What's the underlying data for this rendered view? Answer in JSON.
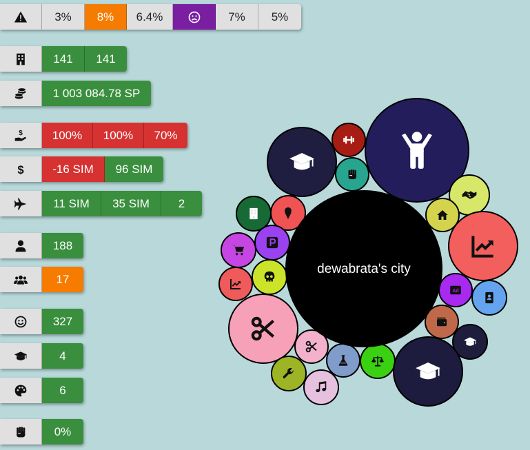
{
  "colors": {
    "background": "#b8d8da",
    "green": "#3a8f3e",
    "red": "#d63232",
    "orange": "#f57c00",
    "purple": "#7b1fa2",
    "grey": "#e0e0e0"
  },
  "stats": {
    "warning_row": {
      "icon": "warning-icon",
      "values": [
        "3%",
        "8%",
        "6.4%",
        "7%",
        "5%"
      ],
      "face_icon": "sad-face-icon"
    },
    "buildings_row": {
      "icon": "building-icon",
      "values": [
        "141",
        "141"
      ]
    },
    "money_row": {
      "icon": "coins-icon",
      "values": [
        "1 003 084.78 SP"
      ]
    },
    "tax_row": {
      "icon": "hand-money-icon",
      "values": [
        "100%",
        "100%",
        "70%"
      ]
    },
    "balance_row": {
      "icon": "dollar-icon",
      "values": [
        "-16 SIM",
        "96 SIM"
      ]
    },
    "travel_row": {
      "icon": "plane-icon",
      "values": [
        "11 SIM",
        "35 SIM",
        "2"
      ]
    },
    "population_row": {
      "icon": "person-icon",
      "values": [
        "188"
      ]
    },
    "groups_row": {
      "icon": "people-icon",
      "values": [
        "17"
      ]
    },
    "happiness_row": {
      "icon": "smile-icon",
      "values": [
        "327"
      ]
    },
    "education_row": {
      "icon": "graduation-cap-icon",
      "values": [
        "4"
      ]
    },
    "culture_row": {
      "icon": "palette-icon",
      "values": [
        "6"
      ]
    },
    "protest_row": {
      "icon": "fist-icon",
      "values": [
        "0%"
      ]
    }
  },
  "city": {
    "name": "dewabrata's city",
    "bubbles": [
      {
        "icon": "graduation-icon",
        "color": "#1f1d40"
      },
      {
        "icon": "dumbbell-icon",
        "color": "#a71d14"
      },
      {
        "icon": "fist-icon",
        "color": "#27a58f"
      },
      {
        "icon": "child-icon",
        "color": "#231d5c"
      },
      {
        "icon": "handshake-icon",
        "color": "#d7e76a"
      },
      {
        "icon": "home-icon",
        "color": "#d4d34e"
      },
      {
        "icon": "chart-icon",
        "color": "#f25f5c"
      },
      {
        "icon": "building-icon",
        "color": "#176a35"
      },
      {
        "icon": "ice-cream-icon",
        "color": "#ef5353"
      },
      {
        "icon": "parking-icon",
        "color": "#9a41f0"
      },
      {
        "icon": "cart-icon",
        "color": "#c646e4"
      },
      {
        "icon": "skull-icon",
        "color": "#cbe42a"
      },
      {
        "icon": "chart-icon",
        "color": "#ef5a5a"
      },
      {
        "icon": "ad-icon",
        "color": "#a829ef"
      },
      {
        "icon": "contact-icon",
        "color": "#64a4ef"
      },
      {
        "icon": "wallet-icon",
        "color": "#c0694a"
      },
      {
        "icon": "graduation-icon",
        "color": "#1e1d3c"
      },
      {
        "icon": "scissors-icon",
        "color": "#f7a1b9"
      },
      {
        "icon": "scissors-icon",
        "color": "#f3b1cc"
      },
      {
        "icon": "flask-icon",
        "color": "#7f9cca"
      },
      {
        "icon": "scale-icon",
        "color": "#3bd113"
      },
      {
        "icon": "graduation-icon",
        "color": "#1d1b3e"
      },
      {
        "icon": "wrench-icon",
        "color": "#9cb425"
      },
      {
        "icon": "music-icon",
        "color": "#e6c1df"
      }
    ]
  }
}
